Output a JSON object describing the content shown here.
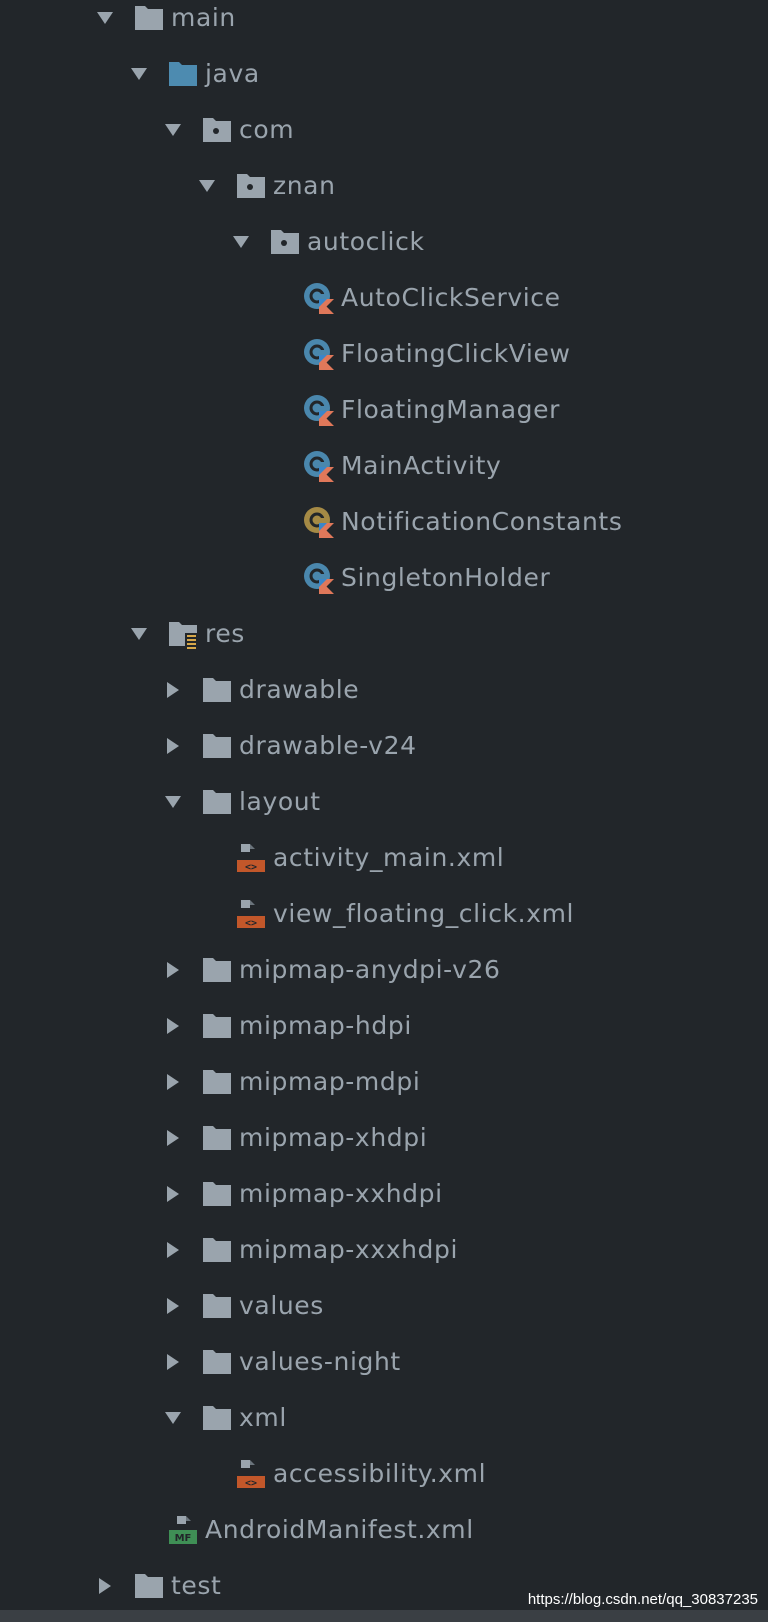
{
  "project_tree": {
    "items": [
      {
        "label": "main",
        "depth": 0,
        "expanded": true,
        "icon": "folder-icon"
      },
      {
        "label": "java",
        "depth": 1,
        "expanded": true,
        "icon": "source-root-folder-icon"
      },
      {
        "label": "com",
        "depth": 2,
        "expanded": true,
        "icon": "package-icon"
      },
      {
        "label": "znan",
        "depth": 3,
        "expanded": true,
        "icon": "package-icon"
      },
      {
        "label": "autoclick",
        "depth": 4,
        "expanded": true,
        "icon": "package-icon"
      },
      {
        "label": "AutoClickService",
        "depth": 5,
        "expanded": null,
        "icon": "kotlin-class-icon"
      },
      {
        "label": "FloatingClickView",
        "depth": 5,
        "expanded": null,
        "icon": "kotlin-class-icon"
      },
      {
        "label": "FloatingManager",
        "depth": 5,
        "expanded": null,
        "icon": "kotlin-class-icon"
      },
      {
        "label": "MainActivity",
        "depth": 5,
        "expanded": null,
        "icon": "kotlin-class-icon"
      },
      {
        "label": "NotificationConstants",
        "depth": 5,
        "expanded": null,
        "icon": "kotlin-object-icon"
      },
      {
        "label": "SingletonHolder",
        "depth": 5,
        "expanded": null,
        "icon": "kotlin-class-icon"
      },
      {
        "label": "res",
        "depth": 1,
        "expanded": true,
        "icon": "resource-root-folder-icon"
      },
      {
        "label": "drawable",
        "depth": 2,
        "expanded": false,
        "icon": "folder-icon"
      },
      {
        "label": "drawable-v24",
        "depth": 2,
        "expanded": false,
        "icon": "folder-icon"
      },
      {
        "label": "layout",
        "depth": 2,
        "expanded": true,
        "icon": "folder-icon"
      },
      {
        "label": "activity_main.xml",
        "depth": 3,
        "expanded": null,
        "icon": "layout-xml-file-icon"
      },
      {
        "label": "view_floating_click.xml",
        "depth": 3,
        "expanded": null,
        "icon": "layout-xml-file-icon"
      },
      {
        "label": "mipmap-anydpi-v26",
        "depth": 2,
        "expanded": false,
        "icon": "folder-icon"
      },
      {
        "label": "mipmap-hdpi",
        "depth": 2,
        "expanded": false,
        "icon": "folder-icon"
      },
      {
        "label": "mipmap-mdpi",
        "depth": 2,
        "expanded": false,
        "icon": "folder-icon"
      },
      {
        "label": "mipmap-xhdpi",
        "depth": 2,
        "expanded": false,
        "icon": "folder-icon"
      },
      {
        "label": "mipmap-xxhdpi",
        "depth": 2,
        "expanded": false,
        "icon": "folder-icon"
      },
      {
        "label": "mipmap-xxxhdpi",
        "depth": 2,
        "expanded": false,
        "icon": "folder-icon"
      },
      {
        "label": "values",
        "depth": 2,
        "expanded": false,
        "icon": "folder-icon"
      },
      {
        "label": "values-night",
        "depth": 2,
        "expanded": false,
        "icon": "folder-icon"
      },
      {
        "label": "xml",
        "depth": 2,
        "expanded": true,
        "icon": "folder-icon"
      },
      {
        "label": "accessibility.xml",
        "depth": 3,
        "expanded": null,
        "icon": "layout-xml-file-icon"
      },
      {
        "label": "AndroidManifest.xml",
        "depth": 1,
        "expanded": null,
        "icon": "manifest-file-icon"
      },
      {
        "label": "test",
        "depth": 0,
        "expanded": false,
        "icon": "folder-icon"
      }
    ]
  },
  "watermark": "https://blog.csdn.net/qq_30837235",
  "colors": {
    "background": "#22262a",
    "text": "#9aa4ad",
    "arrow": "#9aa4ad",
    "folder": "#9aa4ad",
    "source_folder": "#4d8bb0",
    "kotlin_class": "#4a87ad",
    "kotlin_object": "#a58a45",
    "xml_badge": "#c2572a",
    "manifest_badge": "#3f8f55"
  }
}
